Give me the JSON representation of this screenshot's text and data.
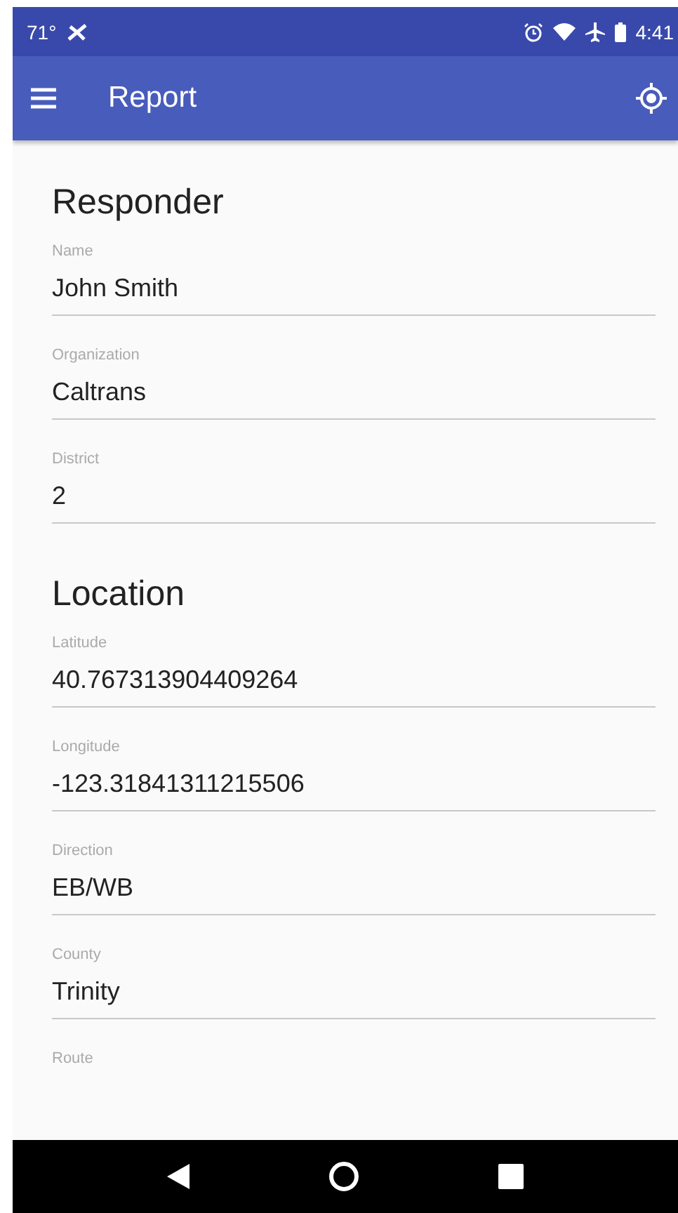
{
  "status_bar": {
    "temperature": "71°",
    "time": "4:41"
  },
  "app_bar": {
    "title": "Report"
  },
  "sections": [
    {
      "title": "Responder",
      "fields": [
        {
          "label": "Name",
          "value": "John Smith"
        },
        {
          "label": "Organization",
          "value": "Caltrans"
        },
        {
          "label": "District",
          "value": "2"
        }
      ]
    },
    {
      "title": "Location",
      "fields": [
        {
          "label": "Latitude",
          "value": "40.767313904409264"
        },
        {
          "label": "Longitude",
          "value": "-123.31841311215506"
        },
        {
          "label": "Direction",
          "value": "EB/WB"
        },
        {
          "label": "County",
          "value": "Trinity"
        },
        {
          "label": "Route"
        }
      ]
    }
  ]
}
